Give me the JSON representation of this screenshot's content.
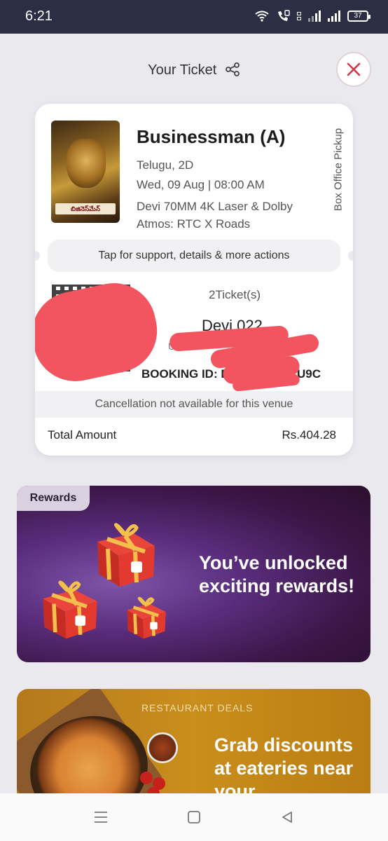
{
  "status_bar": {
    "time": "6:21",
    "battery": "37"
  },
  "header": {
    "title": "Your Ticket"
  },
  "ticket": {
    "poster_text": "బిజినెస్‌మేన్",
    "movie_title": "Businessman (A)",
    "language_format": "Telugu, 2D",
    "datetime": "Wed, 09 Aug | 08:00 AM",
    "venue": "Devi 70MM 4K Laser & Dolby Atmos: RTC X Roads",
    "pickup": "Box Office Pickup",
    "support_text": "Tap for support, details & more actions",
    "ticket_count": "2Ticket(s)",
    "seat": "Devi 022",
    "booking_prefix": "BOOKING ID: D",
    "booking_suffix": "U9C",
    "cancellation": "Cancellation not available for this venue",
    "total_label": "Total Amount",
    "total_value": "Rs.404.28"
  },
  "rewards": {
    "badge": "Rewards",
    "text": "You’ve unlocked exciting rewards!"
  },
  "restaurant": {
    "tag": "RESTAURANT DEALS",
    "text": "Grab discounts at eateries near your"
  },
  "colors": {
    "accent": "#d0394b",
    "redaction": "#f25560",
    "status_bar": "#2c2f44"
  }
}
